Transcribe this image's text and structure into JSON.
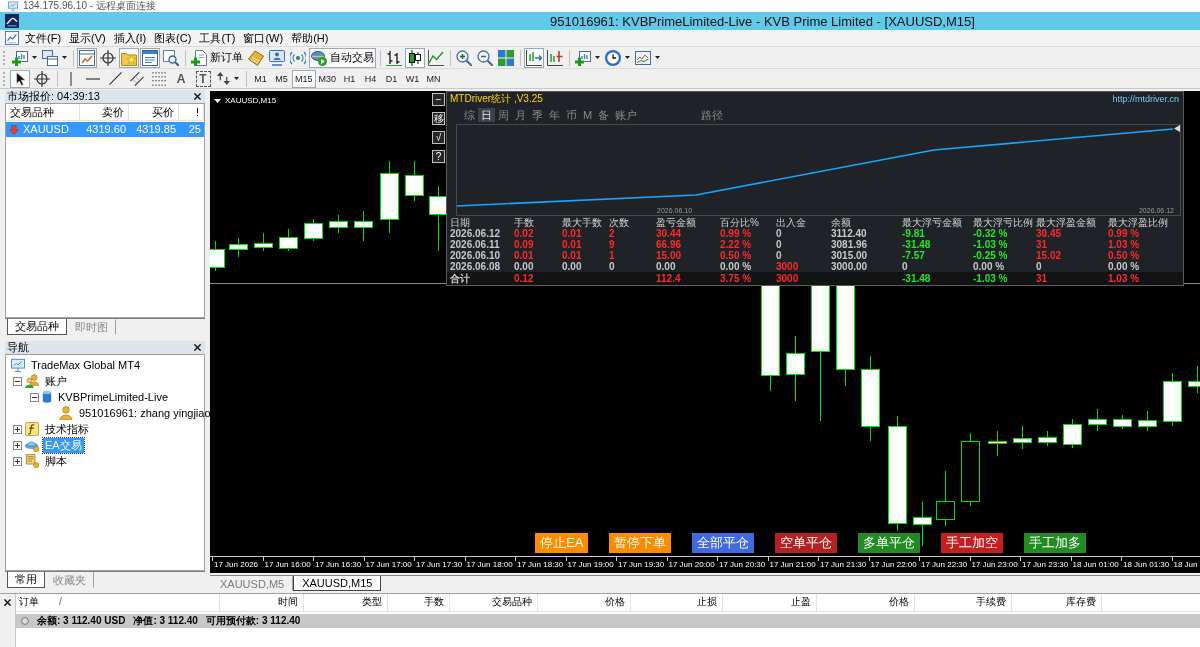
{
  "remote_desktop": {
    "title": "134.175.96.10 - 远程桌面连接"
  },
  "window": {
    "title": "951016961: KVBPrimeLimited-Live - KVB Prime Limited - [XAUUSD,M15]"
  },
  "menu": [
    "文件(F)",
    "显示(V)",
    "插入(I)",
    "图表(C)",
    "工具(T)",
    "窗口(W)",
    "帮助(H)"
  ],
  "toolbar": {
    "groups": [
      [
        {
          "kind": "dropdown",
          "pressed": false
        },
        {
          "kind": "dropdown",
          "pressed": false
        }
      ],
      [
        {
          "kind": "button",
          "pressed": true
        },
        {
          "kind": "button",
          "pressed": false
        },
        {
          "kind": "button",
          "pressed": true
        },
        {
          "kind": "button",
          "pressed": true
        },
        {
          "kind": "button",
          "pressed": false
        }
      ],
      [
        {
          "kind": "text-button",
          "label": "新订单",
          "pressed": false
        },
        {
          "kind": "button",
          "pressed": false
        },
        {
          "kind": "button",
          "pressed": false
        },
        {
          "kind": "button",
          "pressed": false
        },
        {
          "kind": "text-button",
          "label": "自动交易",
          "pressed": true
        }
      ],
      [
        {
          "kind": "button",
          "pressed": false
        },
        {
          "kind": "button",
          "pressed": true
        },
        {
          "kind": "button",
          "pressed": false
        }
      ],
      [
        {
          "kind": "button",
          "pressed": false
        },
        {
          "kind": "button",
          "pressed": false
        },
        {
          "kind": "button",
          "pressed": false
        }
      ],
      [
        {
          "kind": "button",
          "pressed": true
        },
        {
          "kind": "button",
          "pressed": false
        }
      ],
      [
        {
          "kind": "dropdown",
          "pressed": false
        },
        {
          "kind": "dropdown",
          "pressed": false
        },
        {
          "kind": "dropdown",
          "pressed": false
        }
      ]
    ]
  },
  "drawing_toolbar": {
    "groups": [
      [
        {
          "kind": "button",
          "pressed": true
        },
        {
          "kind": "button",
          "pressed": false
        }
      ],
      [
        {
          "kind": "button",
          "pressed": false
        },
        {
          "kind": "button",
          "pressed": false
        },
        {
          "kind": "button",
          "pressed": false
        },
        {
          "kind": "button",
          "pressed": false
        },
        {
          "kind": "button",
          "pressed": false
        },
        {
          "kind": "glyph",
          "label": "A",
          "pressed": false
        },
        {
          "kind": "boxed-glyph",
          "label": "T",
          "pressed": false
        },
        {
          "kind": "dropdown",
          "pressed": false
        }
      ]
    ],
    "timeframes": [
      {
        "label": "M1",
        "selected": false
      },
      {
        "label": "M5",
        "selected": false
      },
      {
        "label": "M15",
        "selected": true
      },
      {
        "label": "M30",
        "selected": false
      },
      {
        "label": "H1",
        "selected": false
      },
      {
        "label": "H4",
        "selected": false
      },
      {
        "label": "D1",
        "selected": false
      },
      {
        "label": "W1",
        "selected": false
      },
      {
        "label": "MN",
        "selected": false
      }
    ]
  },
  "market_watch": {
    "title": "市场报价: 04:39:13",
    "columns": [
      "交易品种",
      "卖价",
      "买价",
      "!"
    ],
    "rows": [
      {
        "symbol": "XAUUSD",
        "bid": "4319.60",
        "ask": "4319.85",
        "spread": "25",
        "selected": true
      }
    ],
    "tabs": [
      {
        "label": "交易品种",
        "selected": true
      },
      {
        "label": "即时图",
        "selected": false
      }
    ]
  },
  "navigator": {
    "title": "导航",
    "tree": [
      {
        "label": "TradeMax Global MT4",
        "selected": false,
        "children": [
          {
            "label": "账户",
            "selected": false,
            "expanded": true,
            "children": [
              {
                "label": "KVBPrimeLimited-Live",
                "selected": false,
                "expanded": true,
                "children": [
                  {
                    "label": "951016961: zhang yingjiao",
                    "selected": false
                  }
                ]
              }
            ]
          },
          {
            "label": "技术指标",
            "selected": false,
            "expanded": false
          },
          {
            "label": "EA交易",
            "selected": true,
            "expanded": false
          },
          {
            "label": "脚本",
            "selected": false,
            "expanded": false
          }
        ]
      }
    ],
    "tabs": [
      {
        "label": "常用",
        "selected": true
      },
      {
        "label": "收藏夹",
        "selected": false
      }
    ]
  },
  "chart": {
    "symbol_label": "XAUUSD,M15",
    "side_buttons": [
      "−",
      "移",
      "√",
      "?"
    ],
    "stats_panel": {
      "title": "MTDriver统计 ,V3.25",
      "link": "http://mtdriver.cn",
      "tabs": [
        {
          "label": "综",
          "selected": false
        },
        {
          "label": "日",
          "selected": true
        },
        {
          "label": "周",
          "selected": false
        },
        {
          "label": "月",
          "selected": false
        },
        {
          "label": "季",
          "selected": false
        },
        {
          "label": "年",
          "selected": false
        },
        {
          "label": "币",
          "selected": false
        },
        {
          "label": "M",
          "selected": false
        },
        {
          "label": "备",
          "selected": false
        },
        {
          "label": "账户",
          "selected": false
        }
      ],
      "path_button": "路径",
      "chart_dates": [
        "2026.06.10",
        "2026.06.12"
      ],
      "columns": [
        "日期",
        "手数",
        "最大手数",
        "次数",
        "盈亏金额",
        "百分比%",
        "出入金",
        "余额",
        "最大浮亏金额",
        "最大浮亏比例",
        "最大浮盈金额",
        "最大浮盈比例"
      ],
      "rows": [
        {
          "cells": [
            {
              "text": "2026.06.12",
              "color": "#c8c8c8"
            },
            {
              "text": "0.02",
              "color": "#ff2828"
            },
            {
              "text": "0.01",
              "color": "#ff2828"
            },
            {
              "text": "2",
              "color": "#ff2828"
            },
            {
              "text": "30.44",
              "color": "#ff2828"
            },
            {
              "text": "0.99 %",
              "color": "#ff2828"
            },
            {
              "text": "0",
              "color": "#c8c8c8"
            },
            {
              "text": "3112.40",
              "color": "#c8c8c8"
            },
            {
              "text": "-9.81",
              "color": "#22e622"
            },
            {
              "text": "-0.32 %",
              "color": "#22e622"
            },
            {
              "text": "30.45",
              "color": "#ff2828"
            },
            {
              "text": "0.99 %",
              "color": "#ff2828"
            }
          ]
        },
        {
          "cells": [
            {
              "text": "2026.06.11",
              "color": "#c8c8c8"
            },
            {
              "text": "0.09",
              "color": "#ff2828"
            },
            {
              "text": "0.01",
              "color": "#ff2828"
            },
            {
              "text": "9",
              "color": "#ff2828"
            },
            {
              "text": "66.96",
              "color": "#ff2828"
            },
            {
              "text": "2.22 %",
              "color": "#ff2828"
            },
            {
              "text": "0",
              "color": "#c8c8c8"
            },
            {
              "text": "3081.96",
              "color": "#c8c8c8"
            },
            {
              "text": "-31.48",
              "color": "#22e622"
            },
            {
              "text": "-1.03 %",
              "color": "#22e622"
            },
            {
              "text": "31",
              "color": "#ff2828"
            },
            {
              "text": "1.03 %",
              "color": "#ff2828"
            }
          ]
        },
        {
          "cells": [
            {
              "text": "2026.06.10",
              "color": "#c8c8c8"
            },
            {
              "text": "0.01",
              "color": "#ff2828"
            },
            {
              "text": "0.01",
              "color": "#ff2828"
            },
            {
              "text": "1",
              "color": "#ff2828"
            },
            {
              "text": "15.00",
              "color": "#ff2828"
            },
            {
              "text": "0.50 %",
              "color": "#ff2828"
            },
            {
              "text": "0",
              "color": "#c8c8c8"
            },
            {
              "text": "3015.00",
              "color": "#c8c8c8"
            },
            {
              "text": "-7.57",
              "color": "#22e622"
            },
            {
              "text": "-0.25 %",
              "color": "#22e622"
            },
            {
              "text": "15.02",
              "color": "#ff2828"
            },
            {
              "text": "0.50 %",
              "color": "#ff2828"
            }
          ]
        },
        {
          "cells": [
            {
              "text": "2026.06.08",
              "color": "#c8c8c8"
            },
            {
              "text": "0.00",
              "color": "#c8c8c8"
            },
            {
              "text": "0.00",
              "color": "#c8c8c8"
            },
            {
              "text": "0",
              "color": "#c8c8c8"
            },
            {
              "text": "0.00",
              "color": "#c8c8c8"
            },
            {
              "text": "0.00 %",
              "color": "#c8c8c8"
            },
            {
              "text": "3000",
              "color": "#ff2828"
            },
            {
              "text": "3000.00",
              "color": "#c8c8c8"
            },
            {
              "text": "0",
              "color": "#c8c8c8"
            },
            {
              "text": "0.00 %",
              "color": "#c8c8c8"
            },
            {
              "text": "0",
              "color": "#c8c8c8"
            },
            {
              "text": "0.00 %",
              "color": "#c8c8c8"
            }
          ]
        }
      ],
      "total": {
        "cells": [
          {
            "text": "合计",
            "color": "#c8c8c8"
          },
          {
            "text": "0.12",
            "color": "#ff2828"
          },
          null,
          null,
          {
            "text": "112.4",
            "color": "#ff2828"
          },
          {
            "text": "3.75 %",
            "color": "#ff2828"
          },
          {
            "text": "3000",
            "color": "#ff2828"
          },
          null,
          {
            "text": "-31.48",
            "color": "#22e622"
          },
          {
            "text": "-1.03 %",
            "color": "#22e622"
          },
          {
            "text": "31",
            "color": "#ff2828"
          },
          {
            "text": "1.03 %",
            "color": "#ff2828"
          }
        ]
      }
    },
    "action_buttons": [
      {
        "label": "停止EA",
        "color": "#ff8c00"
      },
      {
        "label": "暂停下单",
        "color": "#ff8c00"
      },
      {
        "label": "全部平仓",
        "color": "#4169e1"
      },
      {
        "label": "空单平仓",
        "color": "#b22222"
      },
      {
        "label": "多单平仓",
        "color": "#228b22"
      },
      {
        "label": "手工加空",
        "color": "#c41e1e"
      },
      {
        "label": "手工加多",
        "color": "#228b22"
      }
    ],
    "time_axis": [
      "17 Jun 2026",
      "17 Jun 16:00",
      "17 Jun 16:30",
      "17 Jun 17:00",
      "17 Jun 17:30",
      "17 Jun 18:00",
      "17 Jun 18:30",
      "17 Jun 19:00",
      "17 Jun 19:30",
      "17 Jun 20:00",
      "17 Jun 20:30",
      "17 Jun 21:00",
      "17 Jun 21:30",
      "17 Jun 22:00",
      "17 Jun 22:30",
      "17 Jun 23:00",
      "17 Jun 23:30",
      "18 Jun 01:00",
      "18 Jun 01:30",
      "18 Jun"
    ],
    "tabs": [
      {
        "label": "XAUUSD,M5",
        "selected": false
      },
      {
        "label": "XAUUSD,M15",
        "selected": true
      }
    ]
  },
  "terminal": {
    "columns": [
      "订单",
      "时间",
      "类型",
      "手数",
      "交易品种",
      "价格",
      "止损",
      "止盈",
      "价格",
      "手续费",
      "库存费"
    ],
    "sort_mark": "/",
    "summary": [
      "余额: 3 112.40 USD",
      "净值: 3 112.40",
      "可用预付款: 3 112.40"
    ]
  }
}
